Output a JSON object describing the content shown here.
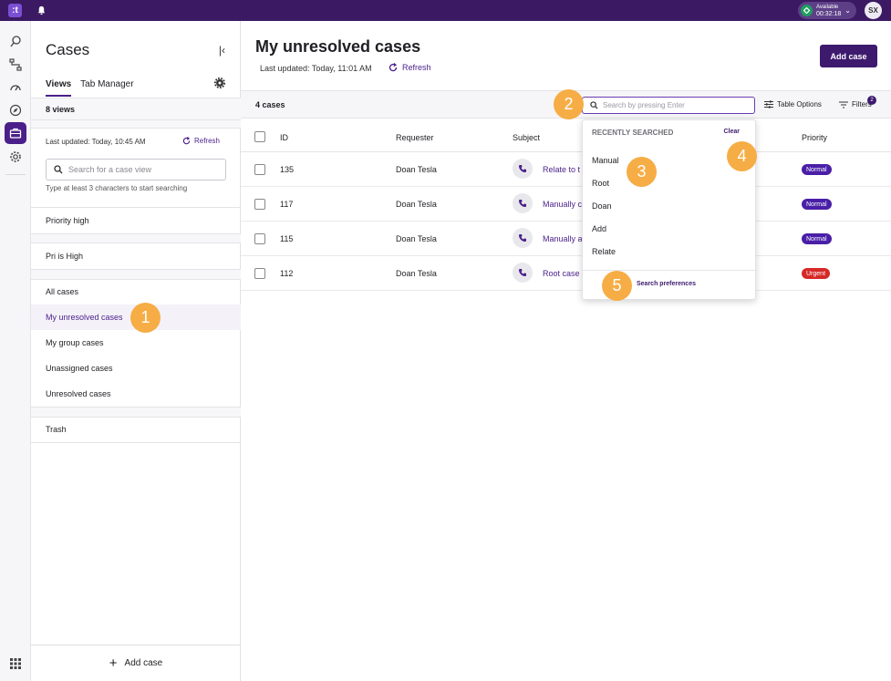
{
  "topbar": {
    "logo": ":t",
    "status": {
      "label": "Available",
      "timer": "00:32:18"
    },
    "avatar": "SX"
  },
  "rail": {
    "icons": [
      "inbox-icon",
      "flow-icon",
      "dashboard-icon",
      "compass-icon",
      "briefcase-icon",
      "gear-icon",
      "apps-grid-icon"
    ]
  },
  "panel": {
    "title": "Cases",
    "tabs": [
      {
        "label": "Views",
        "active": true
      },
      {
        "label": "Tab Manager",
        "active": false
      }
    ],
    "views_count": "8 views",
    "last_updated": "Last updated: Today, 10:45 AM",
    "refresh": "Refresh",
    "search_placeholder": "Search for a case view",
    "hint": "Type at least 3 characters to start searching",
    "views": {
      "v0": "Priority high",
      "v1": "Pri is High",
      "v2": "All cases",
      "v3": "My unresolved cases",
      "v4": "My group cases",
      "v5": "Unassigned cases",
      "v6": "Unresolved cases",
      "v7": "Trash"
    },
    "add_case": "Add case"
  },
  "main": {
    "title": "My unresolved cases",
    "last_updated": "Last updated: Today, 11:01 AM",
    "refresh": "Refresh",
    "add_case": "Add case",
    "case_count": "4 cases",
    "search_placeholder": "Search by pressing Enter",
    "table_options": "Table Options",
    "filters": "Filters",
    "filters_count": "2",
    "columns": {
      "id": "ID",
      "requester": "Requester",
      "subject": "Subject",
      "priority": "Priority"
    },
    "rows": [
      {
        "id": "135",
        "requester": "Doan Tesla",
        "subject": "Relate to t",
        "priority": "Normal"
      },
      {
        "id": "117",
        "requester": "Doan Tesla",
        "subject": "Manually c",
        "priority": "Normal"
      },
      {
        "id": "115",
        "requester": "Doan Tesla",
        "subject": "Manually a",
        "priority": "Normal"
      },
      {
        "id": "112",
        "requester": "Doan Tesla",
        "subject": "Root case",
        "priority": "Urgent"
      }
    ]
  },
  "dropdown": {
    "heading": "RECENTLY SEARCHED",
    "clear": "Clear",
    "items": [
      "Manual",
      "Root",
      "Doan",
      "Add",
      "Relate"
    ],
    "preferences": "Search preferences"
  },
  "callouts": [
    "1",
    "2",
    "3",
    "4",
    "5"
  ],
  "colors": {
    "brand": "#3d1a6e",
    "topbar": "#3b1a63",
    "callout": "#f6ad45",
    "normal": "#4a1fa8",
    "urgent": "#d62828"
  }
}
